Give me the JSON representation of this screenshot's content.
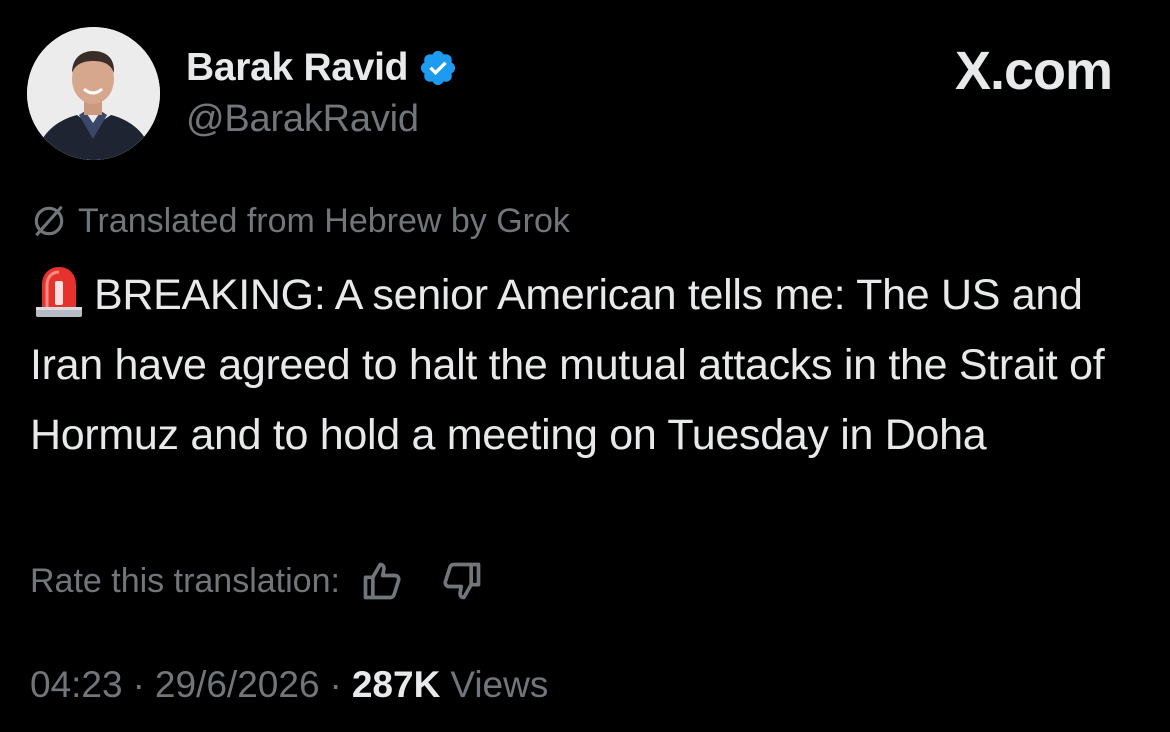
{
  "author": {
    "display_name": "Barak Ravid",
    "handle": "@BarakRavid",
    "verified": true,
    "avatar_icon": "profile-photo"
  },
  "brand": "X.com",
  "translation": {
    "notice": "Translated from Hebrew by Grok",
    "icon": "globe-icon"
  },
  "tweet": {
    "emoji": "siren-emoji",
    "text": "BREAKING: A senior American tells me: The US and Iran have agreed to halt the mutual attacks in the Strait of Hormuz and to hold a meeting on Tuesday in Doha"
  },
  "rate": {
    "label": "Rate this translation:",
    "up_icon": "thumbs-up-icon",
    "down_icon": "thumbs-down-icon"
  },
  "meta": {
    "time": "04:23",
    "date": "29/6/2026",
    "separator": "·",
    "views_count": "287K",
    "views_label": "Views"
  },
  "colors": {
    "background": "#000000",
    "primary_text": "#e7e9ea",
    "secondary_text": "#71767b",
    "verified_blue": "#1d9bf0"
  }
}
